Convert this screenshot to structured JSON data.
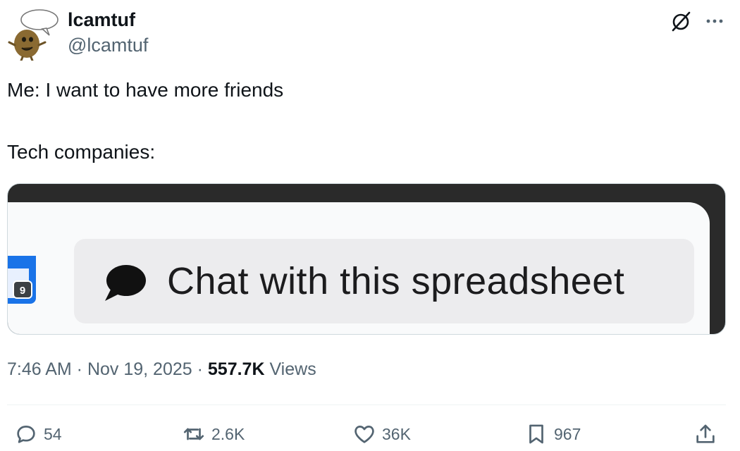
{
  "author": {
    "name": "lcamtuf",
    "handle": "@lcamtuf",
    "avatar_icon": "potato-creature-speech-bubble-avatar"
  },
  "header_icons": {
    "grok": "grok-icon",
    "more": "more-icon"
  },
  "body": {
    "line1": "Me: I want to have more friends",
    "line2": "Tech companies:"
  },
  "media": {
    "chat_label": "Chat with this spreadsheet",
    "sheet_badge": "9",
    "chat_icon": "speech-bubble-icon",
    "accent": "#1a73e8"
  },
  "meta": {
    "time": "7:46 AM",
    "separator1": " · ",
    "date": "Nov 19, 2025",
    "separator2": " · ",
    "views_count": "557.7K",
    "views_label": " Views"
  },
  "actions": {
    "replies": "54",
    "reposts": "2.6K",
    "likes": "36K",
    "bookmarks": "967"
  },
  "colors": {
    "text_primary": "#0f1419",
    "text_secondary": "#536471",
    "divider": "#eff3f4"
  }
}
